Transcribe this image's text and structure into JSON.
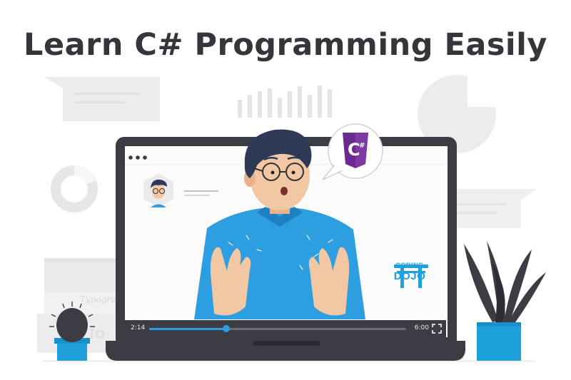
{
  "headline": "Learn C# Programming Easily",
  "player": {
    "current_time": "2:14",
    "total_time": "6:00",
    "progress": 0.3
  },
  "brand": {
    "line1": "CODING",
    "line2": "DOJO"
  },
  "background_text": "Typogra",
  "colors": {
    "title": "#33363a",
    "accent_blue": "#1fa1dc",
    "laptop_frame": "#3c3d44",
    "csharp_purple": "#6a2a8e"
  },
  "icons": [
    "csharp-logo-icon",
    "fullscreen-icon",
    "pie-chart-icon",
    "donut-chart-icon",
    "bar-chart-icon",
    "cactus-icon",
    "plant-icon",
    "torii-gate-icon"
  ]
}
